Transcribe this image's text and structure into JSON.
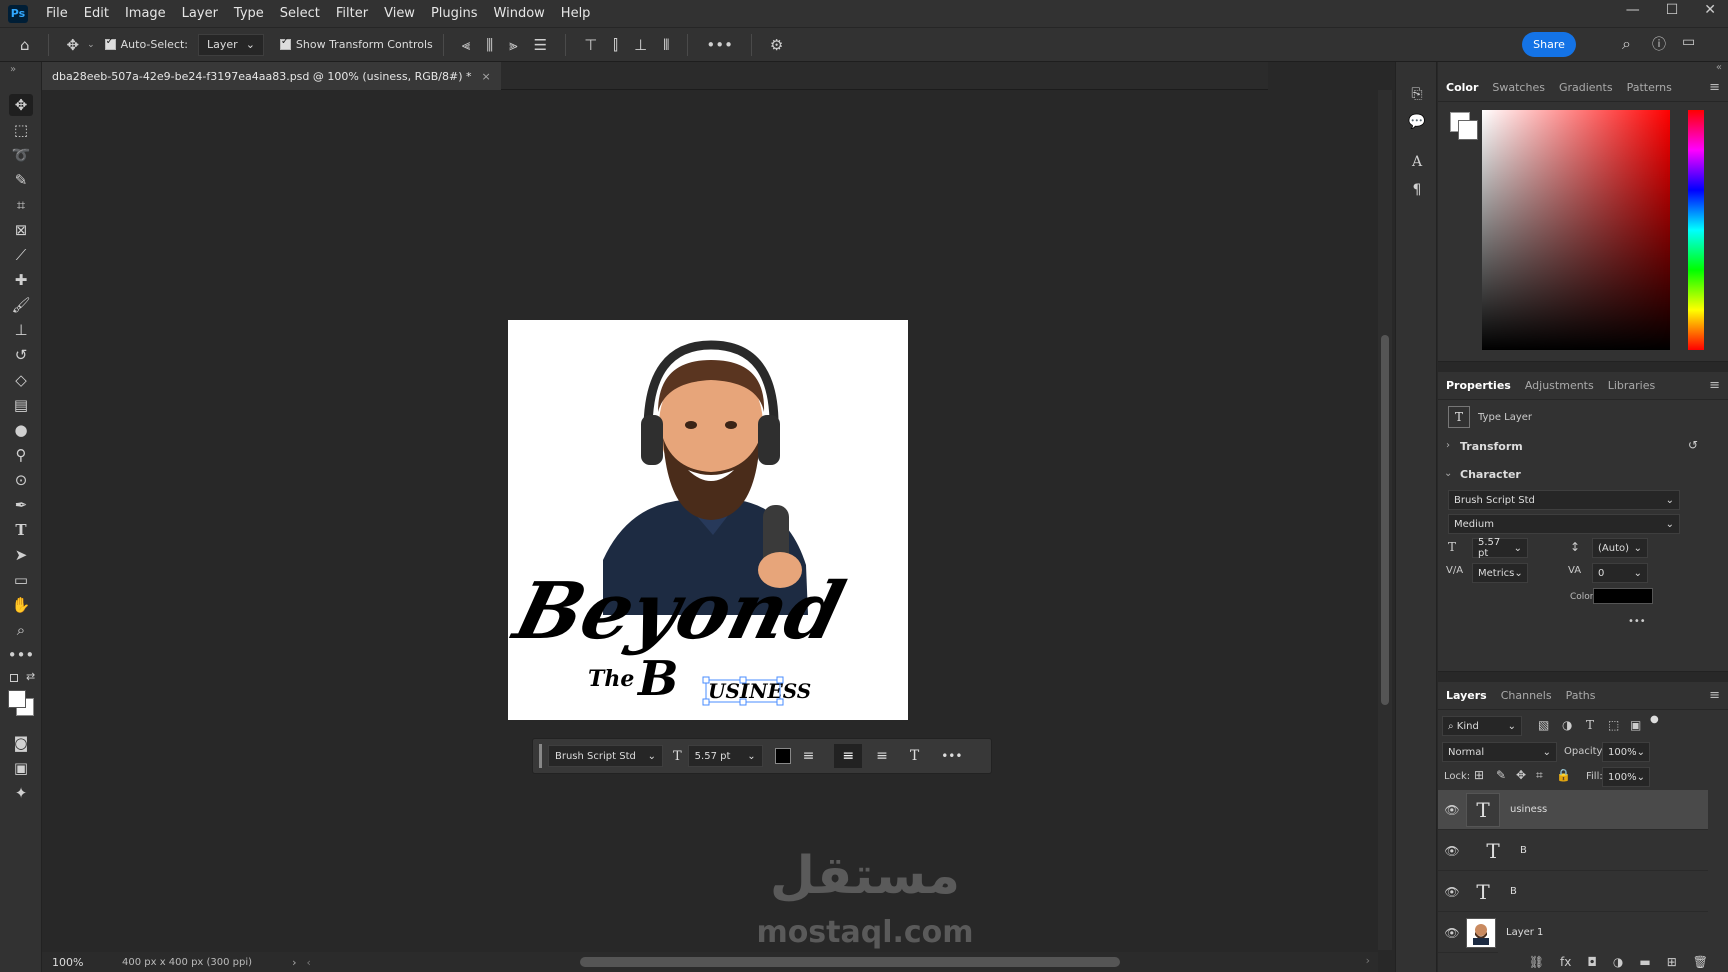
{
  "app": {
    "logo": "Ps"
  },
  "menu": [
    "File",
    "Edit",
    "Image",
    "Layer",
    "Type",
    "Select",
    "Filter",
    "View",
    "Plugins",
    "Window",
    "Help"
  ],
  "window_controls": [
    "—",
    "☐",
    "✕"
  ],
  "options_bar": {
    "auto_select_label": "Auto-Select:",
    "auto_select_value": "Layer",
    "show_transform_label": "Show Transform Controls",
    "share_label": "Share"
  },
  "document_tab": {
    "title": "dba28eeb-507a-42e9-be24-f3197ea4aa83.psd @ 100% (usiness, RGB/8#) *",
    "close": "×"
  },
  "artwork": {
    "line1": "Beyond",
    "line2_a": "The",
    "line2_b": "B",
    "line2_c": "USINESS"
  },
  "context_bar": {
    "font": "Brush Script Std",
    "size": "5.57 pt",
    "more": "•••"
  },
  "status": {
    "zoom": "100%",
    "doc_info": "400 px x 400 px (300 ppi)"
  },
  "watermark": {
    "arabic": "مستقل",
    "latin": "mostaql.com"
  },
  "color_panel": {
    "tabs": [
      "Color",
      "Swatches",
      "Gradients",
      "Patterns"
    ],
    "accent_hue": "#ff0000"
  },
  "properties_panel": {
    "tabs": [
      "Properties",
      "Adjustments",
      "Libraries"
    ],
    "layer_kind": "Type Layer",
    "transform_label": "Transform",
    "character_label": "Character",
    "font_family": "Brush Script Std",
    "font_style": "Medium",
    "font_size": "5.57 pt",
    "leading": "(Auto)",
    "kerning": "Metrics",
    "tracking": "0",
    "color_label": "Color",
    "text_color": "#000000",
    "more": "•••"
  },
  "layers_panel": {
    "tabs": [
      "Layers",
      "Channels",
      "Paths"
    ],
    "filter": "Kind",
    "blend_mode": "Normal",
    "opacity_label": "Opacity:",
    "opacity": "100%",
    "lock_label": "Lock:",
    "fill_label": "Fill:",
    "fill": "100%",
    "layers": [
      {
        "name": "usiness",
        "type": "T"
      },
      {
        "name": "B",
        "type": "T"
      },
      {
        "name": "B",
        "type": "T"
      },
      {
        "name": "Layer 1",
        "type": "img"
      }
    ]
  }
}
